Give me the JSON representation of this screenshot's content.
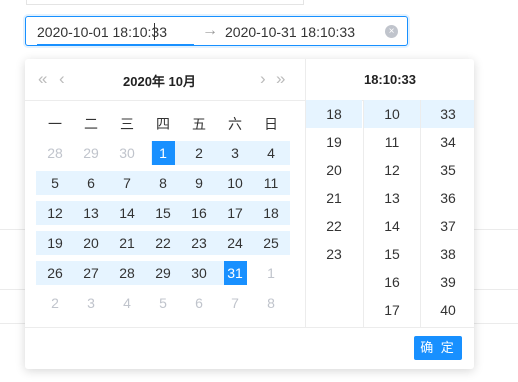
{
  "range": {
    "start": "2020-10-01 18:10:33",
    "end": "2020-10-31 18:10:33",
    "separator": "→",
    "clear_icon": "×"
  },
  "calendar": {
    "nav": {
      "prev_year": "«",
      "prev_month": "‹",
      "next_month": "›",
      "next_year": "»"
    },
    "year_month": "2020年  10月",
    "weekdays": [
      "一",
      "二",
      "三",
      "四",
      "五",
      "六",
      "日"
    ],
    "weeks": [
      [
        "28",
        "29",
        "30",
        "1",
        "2",
        "3",
        "4"
      ],
      [
        "5",
        "6",
        "7",
        "8",
        "9",
        "10",
        "11"
      ],
      [
        "12",
        "13",
        "14",
        "15",
        "16",
        "17",
        "18"
      ],
      [
        "19",
        "20",
        "21",
        "22",
        "23",
        "24",
        "25"
      ],
      [
        "26",
        "27",
        "28",
        "29",
        "30",
        "31",
        "1"
      ],
      [
        "2",
        "3",
        "4",
        "5",
        "6",
        "7",
        "8"
      ]
    ],
    "selected_start": "1",
    "selected_end": "31"
  },
  "time": {
    "title": "18:10:33",
    "hours": [
      "18",
      "19",
      "20",
      "21",
      "22",
      "23"
    ],
    "minutes": [
      "10",
      "11",
      "12",
      "13",
      "14",
      "15",
      "16",
      "17"
    ],
    "seconds": [
      "33",
      "34",
      "35",
      "36",
      "37",
      "38",
      "39",
      "40"
    ]
  },
  "footer": {
    "ok_label": "确 定"
  },
  "colors": {
    "accent": "#1890ff",
    "range_bg": "#e6f4ff",
    "muted": "#c0c4cc"
  }
}
